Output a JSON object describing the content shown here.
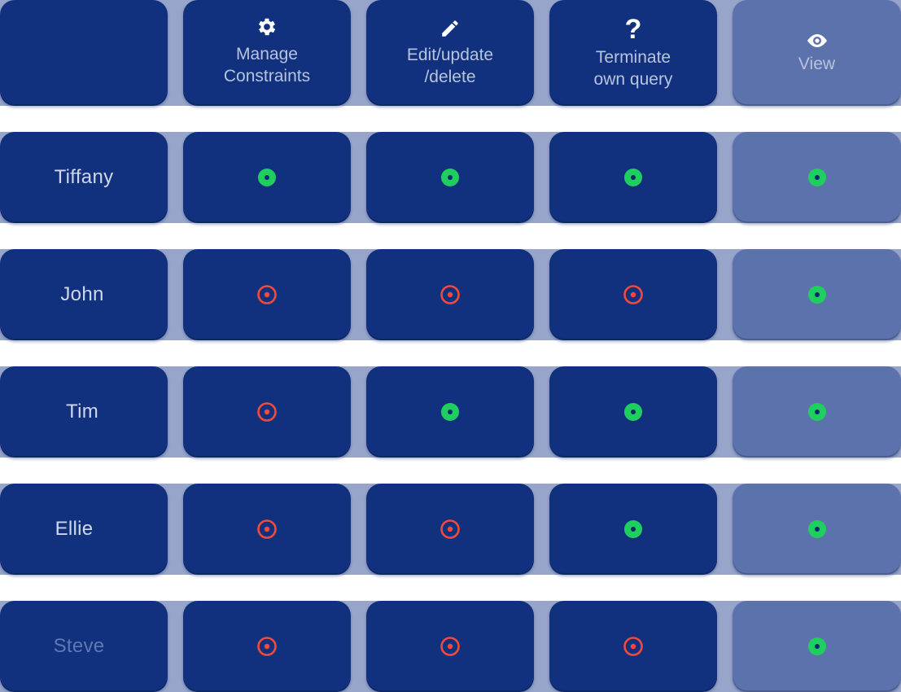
{
  "columns": [
    {
      "label": "",
      "icon": ""
    },
    {
      "label": "Manage\nConstraints",
      "icon": "gear-icon"
    },
    {
      "label": "Edit/update\n/delete",
      "icon": "pencil-icon"
    },
    {
      "label": "Terminate\nown query",
      "icon": "question-mark-icon"
    },
    {
      "label": "View",
      "icon": "eye-icon"
    }
  ],
  "rows": [
    {
      "name": "Tiffany",
      "permissions": [
        "granted",
        "granted",
        "granted",
        "granted"
      ]
    },
    {
      "name": "John",
      "permissions": [
        "denied",
        "denied",
        "denied",
        "granted"
      ]
    },
    {
      "name": "Tim",
      "permissions": [
        "denied",
        "granted",
        "granted",
        "granted"
      ]
    },
    {
      "name": "Ellie",
      "permissions": [
        "denied",
        "denied",
        "granted",
        "granted"
      ]
    },
    {
      "name": "Steve",
      "permissions": [
        "denied",
        "denied",
        "denied",
        "granted"
      ]
    }
  ],
  "colors": {
    "cell_bg": "#11317f",
    "view_cell_bg": "#5c72ad",
    "strip_bg": "#97a5cb",
    "granted": "#1fcf5e",
    "denied": "#f04a3c"
  }
}
